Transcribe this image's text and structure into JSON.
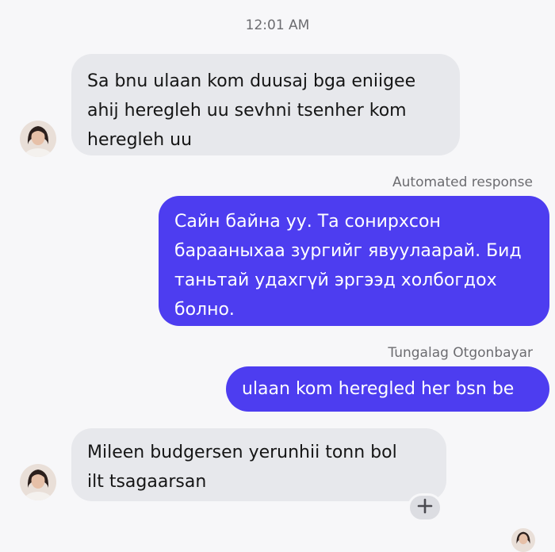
{
  "timestamp": "12:01 AM",
  "messages": [
    {
      "direction": "incoming",
      "lines": [
        "Sa bnu ulaan kom duusaj bga eniigee",
        "ahij heregleh uu sevhni tsenher kom",
        "heregleh uu"
      ]
    },
    {
      "direction": "outgoing",
      "sender": "Automated response",
      "lines": [
        "Сайн байна уу. Та сонирхсон",
        "барааныхаа зургийг явуулаарай. Бид",
        "таньтай удахгүй эргээд холбогдох",
        "болно."
      ]
    },
    {
      "direction": "outgoing",
      "sender": "Tungalag Otgonbayar",
      "lines": [
        "ulaan kom heregled her bsn be"
      ]
    },
    {
      "direction": "incoming",
      "lines": [
        "Mileen budgersen yerunhii tonn bol",
        "ilt tsagaarsan"
      ]
    }
  ],
  "icons": {
    "reaction": "plus-icon",
    "avatar": "avatar"
  },
  "colors": {
    "incoming_bubble": "#e7e8ec",
    "outgoing_bubble": "#4d3df0",
    "background": "#f7f7f9",
    "meta_text": "#6c6c70"
  }
}
